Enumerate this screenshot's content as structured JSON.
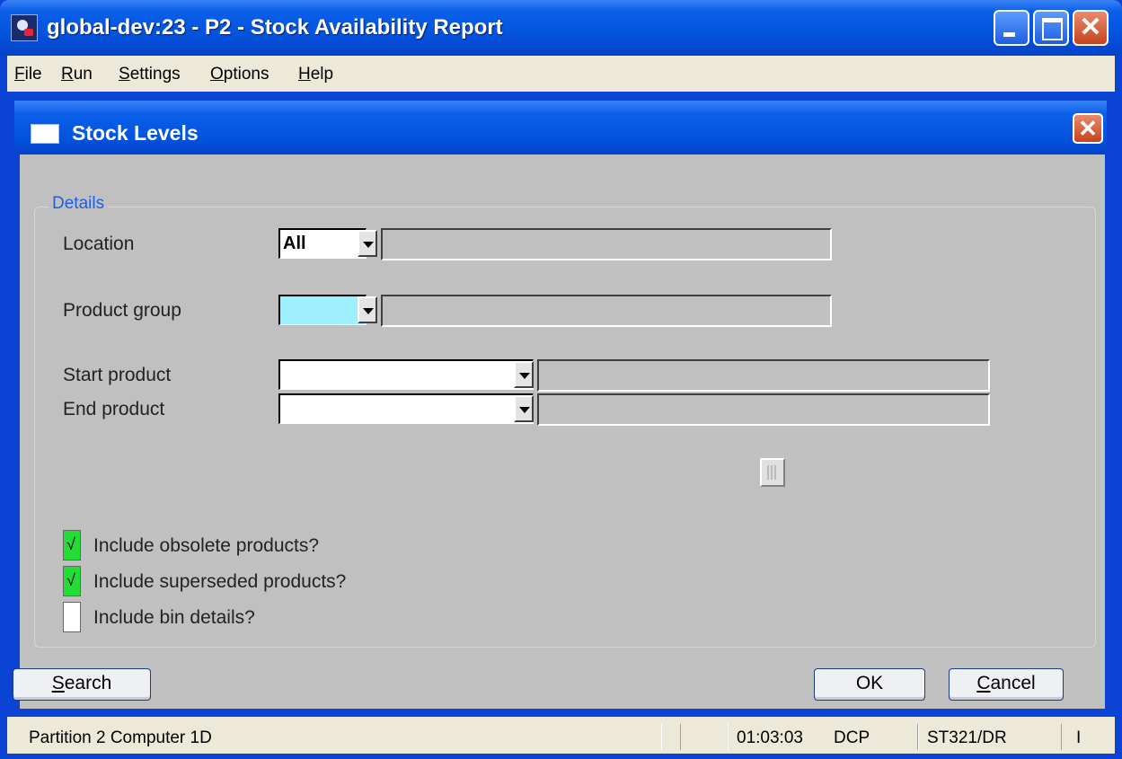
{
  "window": {
    "title": "global-dev:23 - P2 - Stock Availability Report",
    "close_glyph": "✕"
  },
  "menu": {
    "items": [
      {
        "label": "File",
        "u": "F"
      },
      {
        "label": "Run",
        "u": "R"
      },
      {
        "label": "Settings",
        "u": "S"
      },
      {
        "label": "Options",
        "u": "O"
      },
      {
        "label": "Help",
        "u": "H"
      }
    ]
  },
  "dialog": {
    "title": "Stock Levels",
    "close_glyph": "✕"
  },
  "details": {
    "group_label": "Details",
    "location_label": "Location",
    "location_value": "All",
    "location_desc": "",
    "product_group_label": "Product group",
    "product_group_value": "",
    "product_group_desc": "",
    "start_product_label": "Start product",
    "start_product_value": "",
    "start_product_desc": "",
    "end_product_label": "End product",
    "end_product_value": "",
    "end_product_desc": ""
  },
  "options": {
    "include_obsolete_label": "Include obsolete products?",
    "include_obsolete_checked": true,
    "include_superseded_label": "Include superseded products?",
    "include_superseded_checked": true,
    "include_bin_label": "Include bin details?",
    "include_bin_checked": false
  },
  "buttons": {
    "search_label": "Search",
    "ok_label": "OK",
    "cancel_label": "Cancel"
  },
  "status": {
    "partition": "Partition 2 Computer 1D",
    "time": "01:03:03",
    "user": "DCP",
    "program": "ST321/DR",
    "indicator": "I"
  },
  "colors": {
    "titlebar": "#0453dd",
    "client_bg": "#c0c0c0",
    "focus_field": "#9ef0ff",
    "checked": "#22dd33",
    "group_label": "#1f5fe0"
  }
}
